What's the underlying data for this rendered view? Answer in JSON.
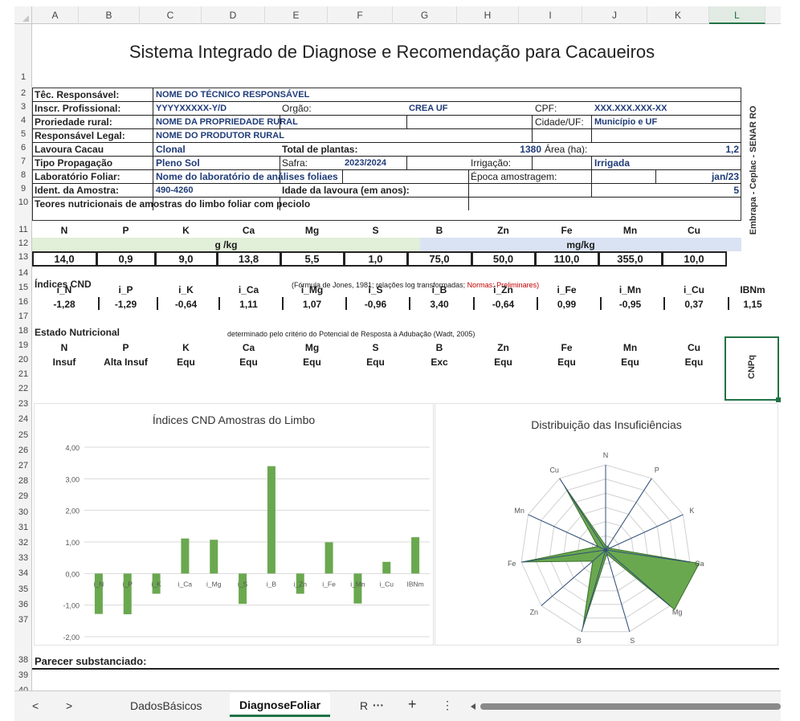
{
  "sheet": {
    "columns": [
      "A",
      "B",
      "C",
      "D",
      "E",
      "F",
      "G",
      "H",
      "I",
      "J",
      "K",
      "L"
    ],
    "rows": [
      "1",
      "2",
      "3",
      "4",
      "5",
      "6",
      "7",
      "8",
      "9",
      "10",
      "11",
      "12",
      "13",
      "14",
      "15",
      "16",
      "17",
      "18",
      "19",
      "20",
      "21",
      "22",
      "23",
      "24",
      "25",
      "26",
      "27",
      "28",
      "29",
      "30",
      "31",
      "32",
      "33",
      "34",
      "35",
      "36",
      "37",
      "38",
      "39",
      "40"
    ],
    "title": "Sistema Integrado de Diagnose e Recomendação para Cacaueiros"
  },
  "form": {
    "tec_label": "Têc. Responsável:",
    "tec_value": "NOME DO TÉCNICO RESPONSÁVEL",
    "inscr_label": "Inscr. Profissional:",
    "inscr_value": "YYYYXXXXX-Y/D",
    "orgao_label": "Orgão:",
    "orgao_value": "CREA UF",
    "cpf_label": "CPF:",
    "cpf_value": "XXX.XXX.XXX-XX",
    "prop_label": "Proriedade rural:",
    "prop_value": "NOME DA PROPRIEDADE RURAL",
    "cidade_label": "Cidade/UF:",
    "cidade_value": "Município e UF",
    "resp_label": "Responsável Legal:",
    "resp_value": "NOME DO PRODUTOR RURAL",
    "lavoura_label": "Lavoura Cacau",
    "lavoura_value": "Clonal",
    "plantas_label": "Total de plantas:",
    "plantas_value": "1380",
    "area_label": "Área (ha):",
    "area_value": "1,2",
    "tipo_label": "Tipo Propagação",
    "tipo_value": "Pleno Sol",
    "safra_label": "Safra:",
    "safra_value": "2023/2024",
    "irrig_label": "Irrigação:",
    "irrig_value": "Irrigada",
    "lab_label": "Laboratório Foliar:",
    "lab_value": "Nome do laboratório de análises foliaes",
    "epoca_label": "Época amostragem:",
    "epoca_value": "jan/23",
    "ident_label": "Ident. da Amostra:",
    "ident_value": "490-4260",
    "idade_label": "Idade da lavoura (em anos):",
    "idade_value": "5",
    "teores_label": "Teores nutricionais  de amostras do limbo foliar com peciolo"
  },
  "nutrients": [
    "N",
    "P",
    "K",
    "Ca",
    "Mg",
    "S",
    "B",
    "Zn",
    "Fe",
    "Mn",
    "Cu"
  ],
  "unit_macro": "g /kg",
  "unit_micro": "mg/kg",
  "teores": [
    "14,0",
    "0,9",
    "9,0",
    "13,8",
    "5,5",
    "1,0",
    "75,0",
    "50,0",
    "110,0",
    "355,0",
    "10,0"
  ],
  "cnd": {
    "label": "Índices CND",
    "note_a": "(Fórmula de Jones, 1981; relações log transformadas; ",
    "note_b": "Normas: Preliminares)",
    "headers": [
      "i_N",
      "i_P",
      "i_K",
      "i_Ca",
      "i_Mg",
      "i_S",
      "i_B",
      "i_Zn",
      "i_Fe",
      "i_Mn",
      "i_Cu",
      "IBNm"
    ],
    "values": [
      "-1,28",
      "-1,29",
      "-0,64",
      "1,11",
      "1,07",
      "-0,96",
      "3,40",
      "-0,64",
      "0,99",
      "-0,95",
      "0,37",
      "1,15"
    ]
  },
  "estado": {
    "label": "Estado Nutricional",
    "note": "determinado pelo critério do Potencial de Resposta à Adubação (Wadt, 2005)",
    "values": [
      "Insuf",
      "Alta Insuf",
      "Equ",
      "Equ",
      "Equ",
      "Equ",
      "Exc",
      "Equ",
      "Equ",
      "Equ",
      "Equ"
    ]
  },
  "side": {
    "vertical": "Embrapa - Ceplac - SENAR RO",
    "cnpq": "CNPq"
  },
  "parecer": "Parecer substanciado:",
  "tabs": {
    "prev": "<",
    "next": ">",
    "t1": "DadosBásicos",
    "t2": "DiagnoseFoliar",
    "t3": "R",
    "more": "···",
    "add": "+",
    "menu": "⋮"
  },
  "chart_data": [
    {
      "type": "bar",
      "title": "Índices CND Amostras do Limbo",
      "categories": [
        "i_N",
        "i_P",
        "i_K",
        "i_Ca",
        "i_Mg",
        "i_S",
        "i_B",
        "i_Zn",
        "i_Fe",
        "i_Mn",
        "i_Cu",
        "IBNm"
      ],
      "values": [
        -1.28,
        -1.29,
        -0.64,
        1.11,
        1.07,
        -0.96,
        3.4,
        -0.64,
        0.99,
        -0.95,
        0.37,
        1.15
      ],
      "ylim": [
        -2,
        4
      ],
      "yticks": [
        "4,00",
        "3,00",
        "2,00",
        "1,00",
        "0,00",
        "-1,00",
        "-2,00"
      ],
      "grid": true,
      "color": "#6aa84f"
    },
    {
      "type": "radar",
      "title": "Distribuição das Insuficiências",
      "categories": [
        "N",
        "P",
        "K",
        "Ca",
        "Mg",
        "S",
        "B",
        "Zn",
        "Fe",
        "Mn",
        "Cu"
      ],
      "values": [
        0.05,
        0.05,
        0.05,
        1.11,
        1.07,
        0.05,
        0.95,
        0.2,
        0.99,
        0.1,
        0.9
      ],
      "color": "#6aa84f"
    }
  ]
}
